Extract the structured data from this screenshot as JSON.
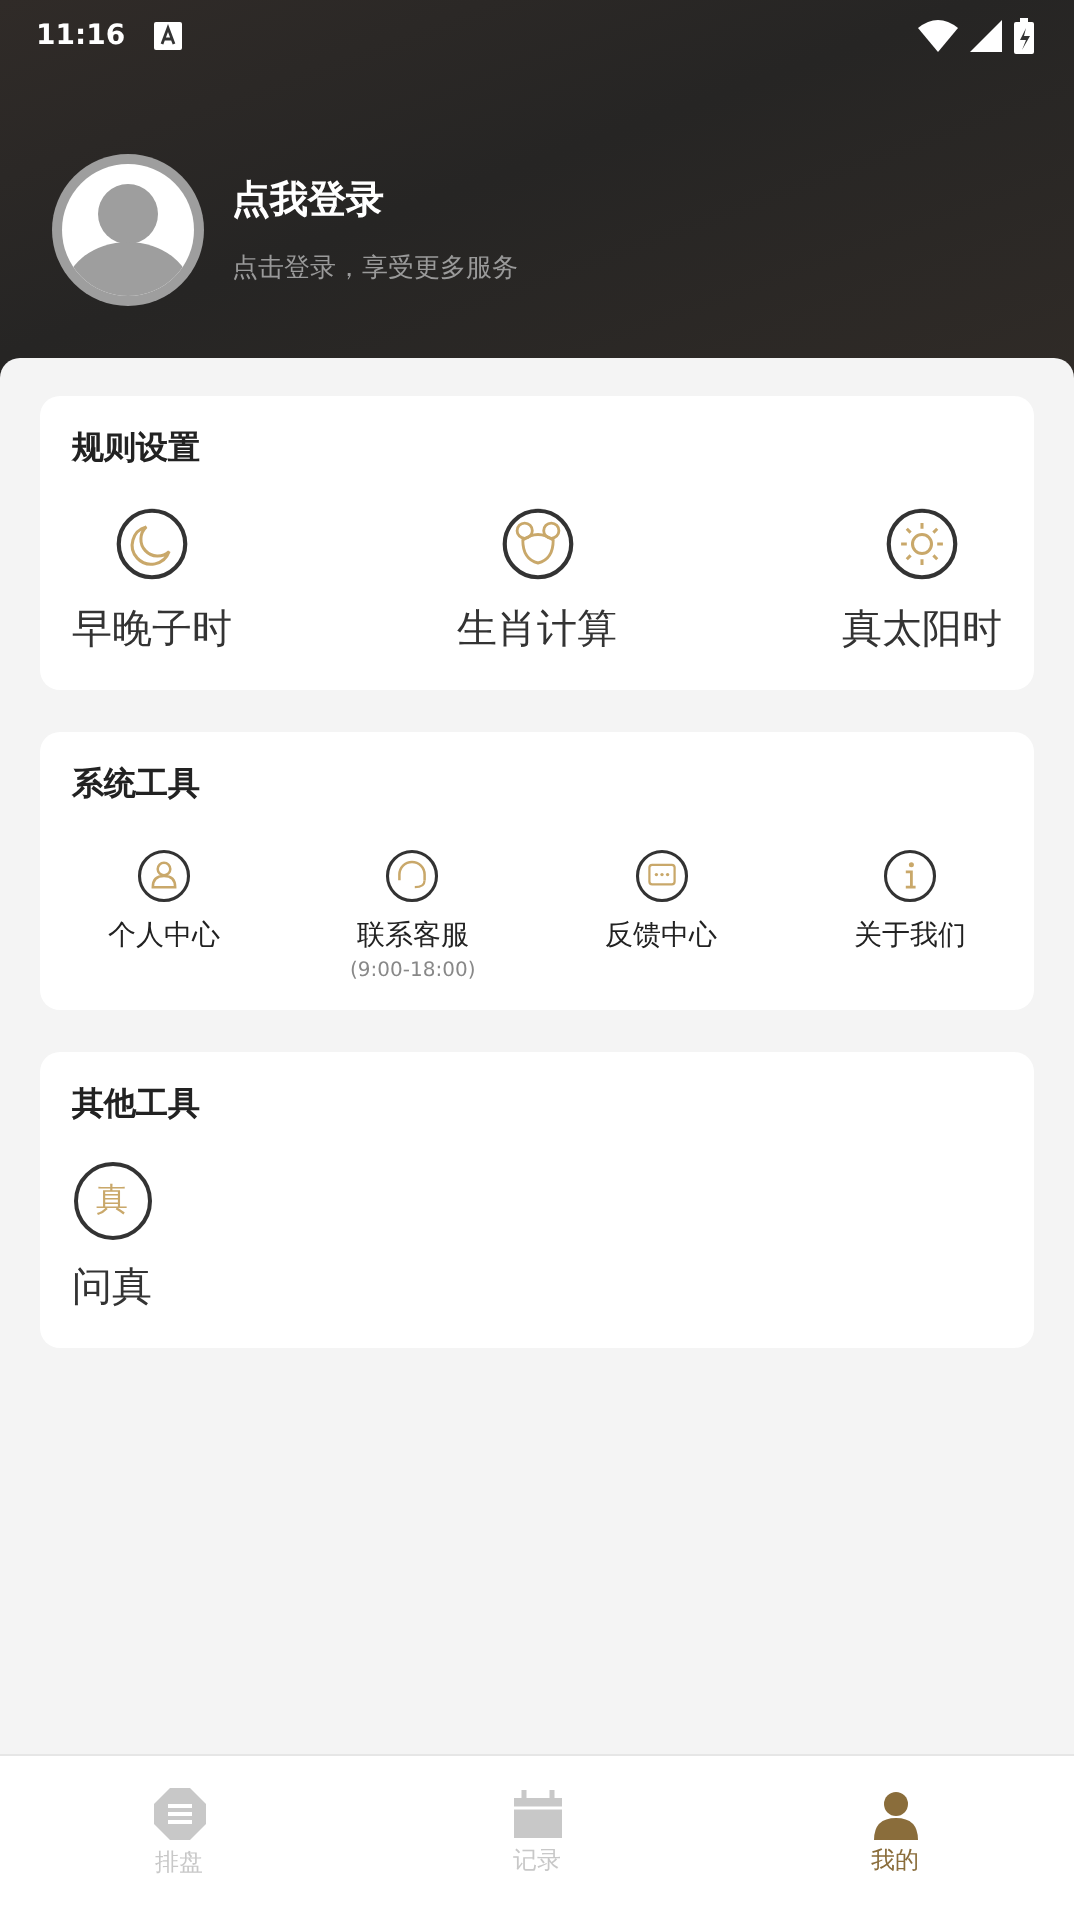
{
  "status_bar": {
    "time": "11:16"
  },
  "profile": {
    "name": "点我登录",
    "subtitle": "点击登录，享受更多服务"
  },
  "sections": [
    {
      "title": "规则设置",
      "items": [
        {
          "label": "早晚子时"
        },
        {
          "label": "生肖计算"
        },
        {
          "label": "真太阳时"
        }
      ]
    },
    {
      "title": "系统工具",
      "items": [
        {
          "label": "个人中心"
        },
        {
          "label": "联系客服",
          "note": "(9:00-18:00)"
        },
        {
          "label": "反馈中心"
        },
        {
          "label": "关于我们"
        }
      ]
    },
    {
      "title": "其他工具",
      "items": [
        {
          "label": "问真",
          "glyph": "真"
        }
      ]
    }
  ],
  "tabs": [
    {
      "label": "排盘",
      "selected": false
    },
    {
      "label": "记录",
      "selected": false
    },
    {
      "label": "我的",
      "selected": true
    }
  ]
}
